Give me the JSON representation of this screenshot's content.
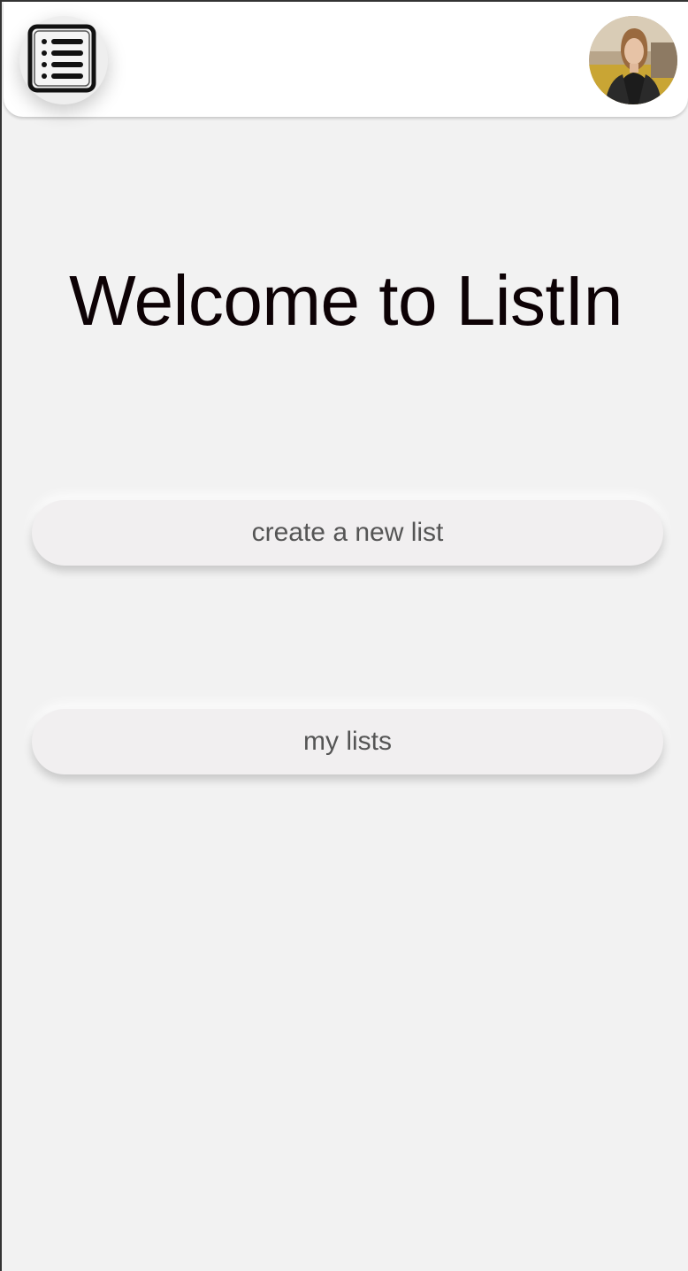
{
  "header": {
    "menu_icon": "list-menu-icon",
    "avatar_icon": "user-avatar"
  },
  "main": {
    "title": "Welcome to ListIn",
    "create_label": "create a new list",
    "lists_label": "my lists"
  },
  "colors": {
    "background": "#f2f2f2",
    "header": "#ffffff",
    "title": "#0d0205",
    "button_bg": "#f1eff0",
    "button_text": "#555555"
  }
}
